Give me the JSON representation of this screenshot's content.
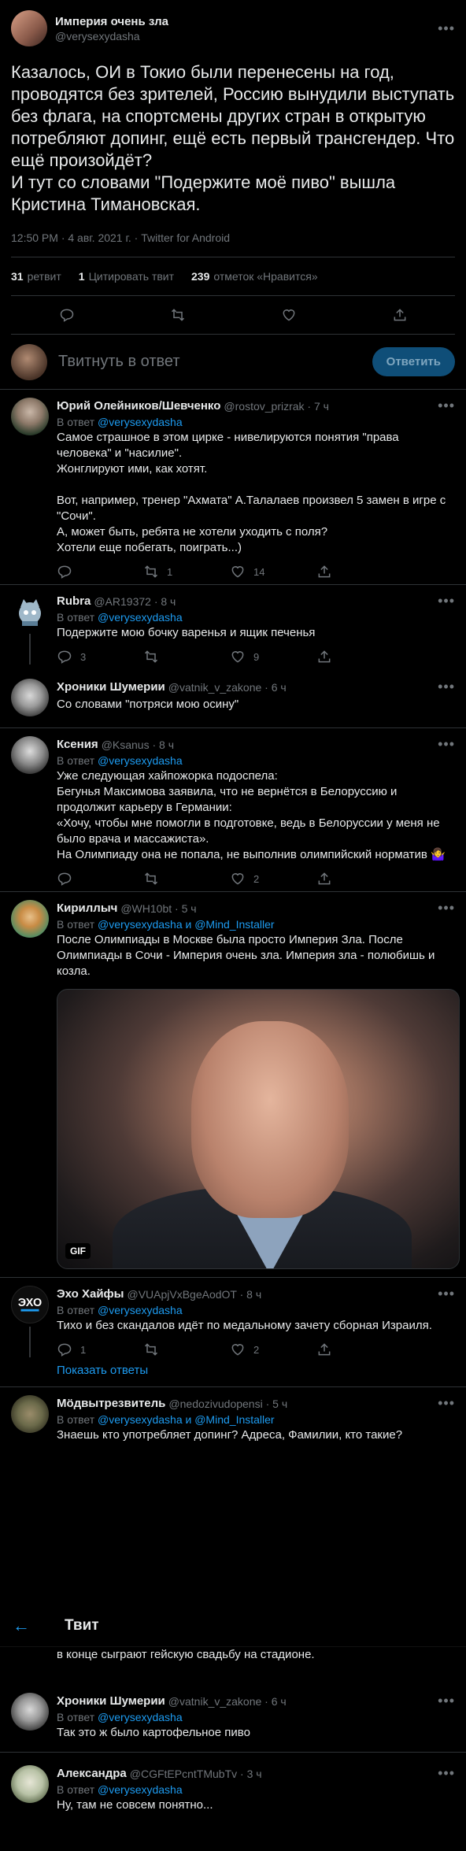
{
  "main_tweet": {
    "name": "Империя очень зла",
    "handle": "@verysexydasha",
    "text": "Казалось, ОИ в Токио были перенесены на год, проводятся без зрителей, Россию вынудили выступать без флага, на спортсмены других стран в открытую потребляют допинг, ещё есть первый трансгендер. Что ещё произойдёт?\nИ тут со словами \"Подержите моё пиво\" вышла Кристина Тимановская.",
    "meta": "12:50 PM · 4 авг. 2021 г. · Twitter for Android",
    "retweets_count": "31",
    "retweets_label": "ретвит",
    "quotes_count": "1",
    "quotes_label": "Цитировать твит",
    "likes_count": "239",
    "likes_label": "отметок «Нравится»",
    "icons": [
      "reply-icon",
      "retweet-icon",
      "like-icon",
      "share-icon"
    ]
  },
  "reply_box": {
    "placeholder": "Твитнуть в ответ",
    "button": "Ответить"
  },
  "replies": [
    {
      "name": "Юрий Олейников/Шевченко",
      "meta": "@rostov_prizrak · 7 ч",
      "reply_prefix": "В ответ",
      "reply_to": "@verysexydasha",
      "text": "Самое страшное в этом цирке - нивелируются понятия \"права человека\" и \"насилие\".\nЖонглируют ими, как хотят.\n\nВот, например, тренер \"Ахмата\" А.Талалаев произвел 5 замен в игре с \"Сочи\".\nА, может быть, ребята не хотели уходить с поля?\nХотели еще побегать, поиграть...)",
      "replies": "",
      "retweets": "1",
      "likes": "14"
    },
    {
      "name": "Rubra",
      "meta": "@AR19372 · 8 ч",
      "reply_prefix": "В ответ",
      "reply_to": "@verysexydasha",
      "text": "Подержите мою бочку варенья и ящик печенья",
      "replies": "3",
      "retweets": "",
      "likes": "9"
    },
    {
      "name": "Хроники Шумерии",
      "meta": "@vatnik_v_zakone · 6 ч",
      "text": "Со словами \"потряси мою осину\""
    },
    {
      "name": "Ксения",
      "meta": "@Ksanus · 8 ч",
      "reply_prefix": "В ответ",
      "reply_to": "@verysexydasha",
      "text": "Уже следующая хайпожорка подоспела:\nБегунья Максимова заявила, что не вернётся в Белоруссию и продолжит карьеру в Германии:\n«Хочу, чтобы мне помогли в подготовке, ведь в Белоруссии у меня не было врача и массажиста».\nНа Олимпиаду она не попала, не выполнив олимпийский норматив 🤷‍♀️",
      "replies": "",
      "retweets": "",
      "likes": "2"
    },
    {
      "name": "Кириллыч",
      "meta": "@WH10bt · 5 ч",
      "reply_prefix": "В ответ",
      "reply_to": "@verysexydasha и @Mind_Installer",
      "text": "После Олимпиады в Москве была просто Империя Зла. После Олимпиады в Сочи - Империя очень зла. Империя зла - полюбишь и козла.",
      "gif_label": "GIF"
    },
    {
      "name": "Эхо Хайфы",
      "meta": "@VUApjVxBgeAodOT · 8 ч",
      "reply_prefix": "В ответ",
      "reply_to": "@verysexydasha",
      "text": "Тихо и без скандалов идёт по медальному зачету сборная Израиля.",
      "replies": "1",
      "retweets": "",
      "likes": "2",
      "show_more": "Показать ответы"
    },
    {
      "name": "Мöдвытрезвитель",
      "meta": "@nedozivudopensi · 5 ч",
      "reply_prefix": "В ответ",
      "reply_to": "@verysexydasha и @Mind_Installer",
      "text": "Знаешь кто употребляет допинг? Адреса, Фамилии, кто такие?",
      "partial_line": "в конце сыграют гейскую свадьбу на стадионе."
    },
    {
      "name": "Хроники Шумерии",
      "meta": "@vatnik_v_zakone · 6 ч",
      "reply_prefix": "В ответ",
      "reply_to": "@verysexydasha",
      "text": "Так это ж было картофельное пиво"
    },
    {
      "name": "Александра",
      "meta": "@CGFtEPcntTMubTv · 3 ч",
      "reply_prefix": "В ответ",
      "reply_to": "@verysexydasha",
      "text": "Ну, там не совсем понятно..."
    }
  ],
  "sticky_header": {
    "back_icon": "arrow-left-icon",
    "title": "Твит"
  },
  "colors": {
    "background": "#000000",
    "text": "#e7e9ea",
    "muted": "#71767b",
    "accent": "#1d9bf0",
    "divider": "#2f3336"
  }
}
